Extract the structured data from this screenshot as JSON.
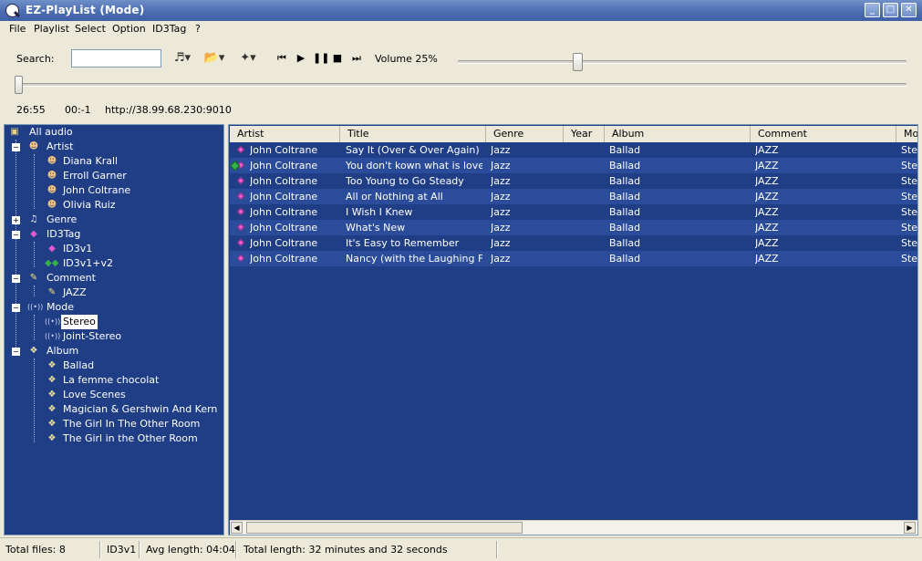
{
  "window": {
    "title": "EZ-PlayList (Mode)",
    "minimize": "_",
    "maximize": "□",
    "close": "✕"
  },
  "menu": [
    "File",
    "Playlist",
    "Select",
    "Option",
    "ID3Tag",
    "?"
  ],
  "toolbar": {
    "search_label": "Search:",
    "search_value": "",
    "volume_label": "Volume 25%",
    "volume_percent": 25,
    "seek_percent": 0
  },
  "player": {
    "time": "26:55",
    "position": "00:-1",
    "stream_url": "http://38.99.68.230:9010"
  },
  "tree": [
    {
      "label": "All audio"
    },
    {
      "label": "Artist"
    },
    {
      "label": "Diana Krall"
    },
    {
      "label": "Erroll Garner"
    },
    {
      "label": "John Coltrane"
    },
    {
      "label": "Olivia Ruiz"
    },
    {
      "label": "Genre"
    },
    {
      "label": "ID3Tag"
    },
    {
      "label": "ID3v1"
    },
    {
      "label": "ID3v1+v2"
    },
    {
      "label": "Comment"
    },
    {
      "label": "JAZZ"
    },
    {
      "label": "Mode"
    },
    {
      "label": "Stereo"
    },
    {
      "label": "Joint-Stereo"
    },
    {
      "label": "Album"
    },
    {
      "label": "Ballad"
    },
    {
      "label": "La femme chocolat"
    },
    {
      "label": "Love Scenes"
    },
    {
      "label": "Magician & Gershwin And Kern"
    },
    {
      "label": "The Girl In The Other Room"
    },
    {
      "label": "The Girl in the Other Room"
    }
  ],
  "columns": [
    "Artist",
    "Title",
    "Genre",
    "Year",
    "Album",
    "Comment",
    "Mo"
  ],
  "rows": [
    {
      "artist": "John Coltrane",
      "title": "Say It (Over & Over Again)",
      "genre": "Jazz",
      "year": "",
      "album": "Ballad",
      "comment": "JAZZ",
      "mode": "Ste"
    },
    {
      "artist": "John Coltrane",
      "title": "You don't kown what is love",
      "genre": "Jazz",
      "year": "",
      "album": "Ballad",
      "comment": "JAZZ",
      "mode": "Ste"
    },
    {
      "artist": "John Coltrane",
      "title": "Too Young to Go Steady",
      "genre": "Jazz",
      "year": "",
      "album": "Ballad",
      "comment": "JAZZ",
      "mode": "Ste"
    },
    {
      "artist": "John Coltrane",
      "title": "All or Nothing at All",
      "genre": "Jazz",
      "year": "",
      "album": "Ballad",
      "comment": "JAZZ",
      "mode": "Ste"
    },
    {
      "artist": "John Coltrane",
      "title": "I Wish I Knew",
      "genre": "Jazz",
      "year": "",
      "album": "Ballad",
      "comment": "JAZZ",
      "mode": "Ste"
    },
    {
      "artist": "John Coltrane",
      "title": "What's New",
      "genre": "Jazz",
      "year": "",
      "album": "Ballad",
      "comment": "JAZZ",
      "mode": "Ste"
    },
    {
      "artist": "John Coltrane",
      "title": "It's Easy to Remember",
      "genre": "Jazz",
      "year": "",
      "album": "Ballad",
      "comment": "JAZZ",
      "mode": "Ste"
    },
    {
      "artist": "John Coltrane",
      "title": "Nancy (with the Laughing Fa...",
      "genre": "Jazz",
      "year": "",
      "album": "Ballad",
      "comment": "JAZZ",
      "mode": "Ste"
    }
  ],
  "status": {
    "total_files": "Total files: 8",
    "tag": "ID3v1",
    "avg_length": "Avg length: 04:04",
    "total_length": "Total length: 32 minutes and 32 seconds"
  },
  "colors": {
    "panel_bg": "#1f3e86",
    "row_alt": "#2a4c9a",
    "titlebar": "#4d6db3"
  }
}
